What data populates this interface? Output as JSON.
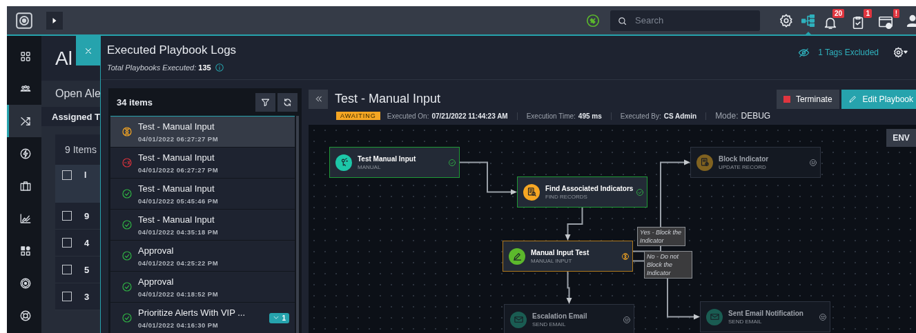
{
  "topbar": {
    "search": {
      "placeholder": "Search"
    },
    "icons": [
      {
        "kind": "settings",
        "selected": false
      },
      {
        "kind": "hierarchy",
        "selected": true
      },
      {
        "kind": "bell",
        "selected": false,
        "badge": "20"
      },
      {
        "kind": "clipboard",
        "selected": false,
        "badge": "1"
      },
      {
        "kind": "window-gear",
        "selected": false,
        "badge": "!"
      }
    ]
  },
  "sidebar": {
    "items": [
      {
        "kind": "grid",
        "selected": false
      },
      {
        "kind": "people",
        "selected": false
      },
      {
        "kind": "shuffle",
        "selected": true
      },
      {
        "kind": "bolt",
        "selected": false
      },
      {
        "kind": "briefcase",
        "selected": false
      },
      {
        "kind": "chart",
        "selected": false
      },
      {
        "kind": "apps",
        "selected": false
      },
      {
        "kind": "radar",
        "selected": false
      },
      {
        "kind": "lifebuoy",
        "selected": false
      }
    ]
  },
  "background_page": {
    "title": "Al",
    "tab": "Open Ale",
    "filter": "Assigned T",
    "count": "9 Items",
    "column_1": "I",
    "header_checked": false,
    "rows": [
      {
        "cell": "9",
        "checked": false
      },
      {
        "cell": "4",
        "checked": false
      },
      {
        "cell": "5",
        "checked": false
      },
      {
        "cell": "3",
        "checked": false
      }
    ]
  },
  "panel": {
    "title": "Executed Playbook Logs",
    "subtitle": "*Total Playbooks Executed:* **135**",
    "tags": "1 Tags Excluded",
    "list": {
      "count": "34 items",
      "items": [
        {
          "title": "Test - Manual Input",
          "time": "04/01/2022 06:27:27 PM",
          "awaiting": true,
          "failed": false,
          "completed": false,
          "selected": true
        },
        {
          "title": "Test - Manual Input",
          "time": "04/01/2022 06:27:27 PM",
          "awaiting": false,
          "failed": true,
          "completed": false,
          "selected": false
        },
        {
          "title": "Test - Manual Input",
          "time": "04/01/2022 05:45:46 PM",
          "awaiting": false,
          "failed": false,
          "completed": true,
          "selected": false
        },
        {
          "title": "Test - Manual Input",
          "time": "04/01/2022 04:35:18 PM",
          "awaiting": false,
          "failed": false,
          "completed": true,
          "selected": false
        },
        {
          "title": "Approval",
          "time": "04/01/2022 04:25:22 PM",
          "awaiting": false,
          "failed": false,
          "completed": true,
          "selected": false
        },
        {
          "title": "Approval",
          "time": "04/01/2022 04:18:52 PM",
          "awaiting": false,
          "failed": false,
          "completed": true,
          "selected": false
        },
        {
          "title": "Prioritize Alerts With VIP ...",
          "time": "04/01/2022 04:16:30 PM",
          "awaiting": false,
          "failed": false,
          "completed": true,
          "selected": false,
          "badge": "1"
        }
      ]
    },
    "detail": {
      "title": "Test - Manual Input",
      "buttons": [
        {
          "kind": "terminate",
          "label": "Terminate"
        },
        {
          "kind": "edit",
          "label": "Edit Playbook"
        }
      ],
      "status": "AWAITING",
      "meta": [
        {
          "label": "Executed On:",
          "value": "07/21/2022 11:44:23 AM"
        },
        {
          "label": "Execution Time:",
          "value": "495 ms"
        },
        {
          "label": "Executed By:",
          "value": "CS Admin"
        },
        {
          "label": "Mode:",
          "value": "DEBUG",
          "kind": "mode"
        }
      ],
      "env": "ENV",
      "nodes": [
        {
          "title": "Test Manual Input",
          "type": "MANUAL",
          "kind": "manual",
          "completed": true,
          "awaiting": false
        },
        {
          "title": "Find Associated Indicators",
          "type": "FIND RECORDS",
          "kind": "find",
          "completed": true,
          "awaiting": false
        },
        {
          "title": "Manual Input Test",
          "type": "MANUAL INPUT",
          "kind": "input",
          "completed": false,
          "awaiting": true
        },
        {
          "title": "Escalation Email",
          "type": "SEND EMAIL",
          "kind": "email",
          "completed": false,
          "awaiting": false
        },
        {
          "title": "Block Indicator",
          "type": "UPDATE RECORD",
          "kind": "update",
          "completed": false,
          "awaiting": false
        },
        {
          "title": "Sent Email Notification",
          "type": "SEND EMAIL",
          "kind": "email",
          "completed": false,
          "awaiting": false
        }
      ],
      "edge_labels": [
        "Yes - Block the Indicator",
        "No - Do not Block the Indicator"
      ]
    }
  }
}
